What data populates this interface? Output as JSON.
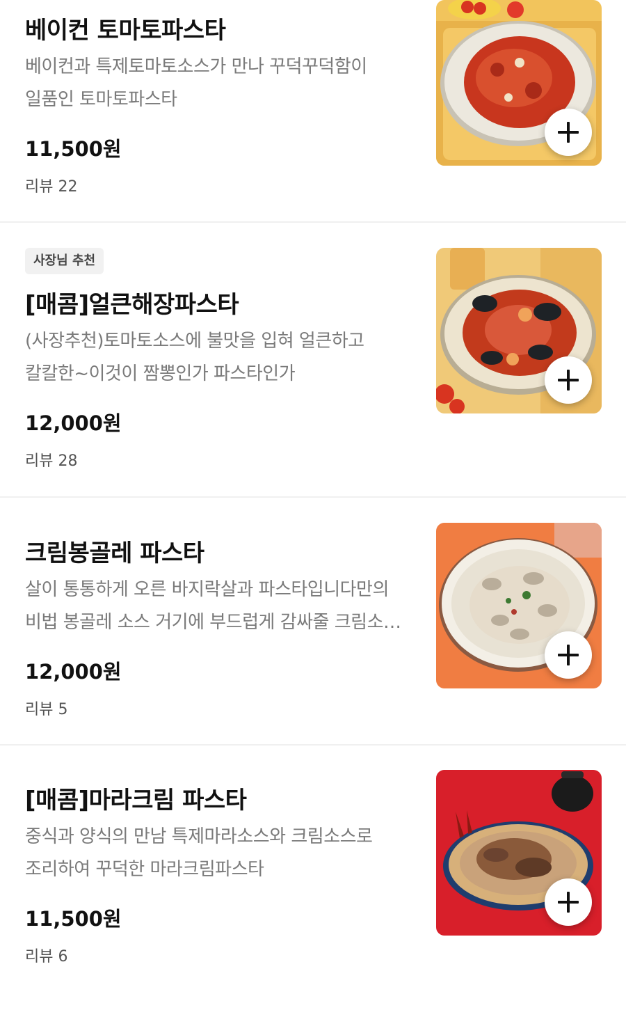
{
  "items": [
    {
      "badge": "",
      "title": "베이컨 토마토파스타",
      "desc_line1": "베이컨과 특제토마토소스가 만나 꾸덕꾸덕함이",
      "desc_line2": "일품인 토마토파스타",
      "price": "11,500원",
      "review": "리뷰 22",
      "image_icon": "tomato-pasta-photo",
      "photo_colors": {
        "bg": "#f2c45c",
        "plate": "#e9e6df",
        "food": "#c8361e"
      }
    },
    {
      "badge": "사장님 추천",
      "title": "[매콤]얼큰해장파스타",
      "desc_line1": "(사장추천)토마토소스에 불맛을 입혀 얼큰하고",
      "desc_line2": "칼칼한~이것이 짬뽕인가 파스타인가",
      "price": "12,000원",
      "review": "리뷰 28",
      "image_icon": "seafood-pasta-photo",
      "photo_colors": {
        "bg": "#f0c978",
        "plate": "#ede4cf",
        "food": "#c23a1c"
      }
    },
    {
      "badge": "",
      "title": "크림봉골레 파스타",
      "desc_line1": "살이 통통하게 오른 바지락살과 파스타입니다만의",
      "desc_line2": "비법 봉골레 소스 거기에 부드럽게  감싸줄 크림소…",
      "price": "12,000원",
      "review": "리뷰 5",
      "image_icon": "clam-pasta-photo",
      "photo_colors": {
        "bg": "#f07d42",
        "plate": "#f3efe6",
        "food": "#e6dccb"
      }
    },
    {
      "badge": "",
      "title": "[매콤]마라크림 파스타",
      "desc_line1": "중식과 양식의 만남 특제마라소스와 크림소스로",
      "desc_line2": "조리하여 꾸덕한 마라크림파스타",
      "price": "11,500원",
      "review": "리뷰 6",
      "image_icon": "mala-pasta-photo",
      "photo_colors": {
        "bg": "#d81f2a",
        "plate": "#c9a27a",
        "food": "#8a5a3a"
      }
    }
  ],
  "add_icon": "plus-icon"
}
